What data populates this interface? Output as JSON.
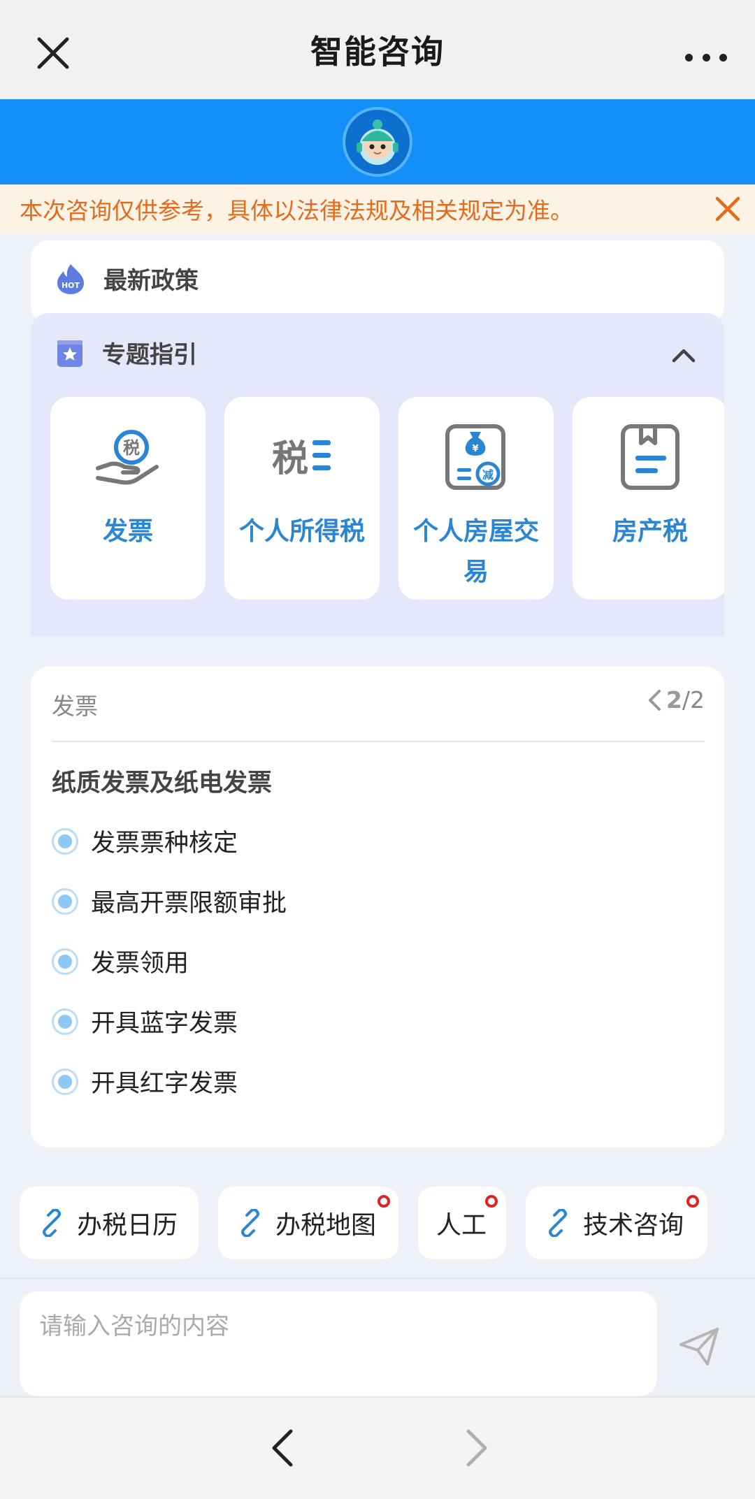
{
  "header": {
    "title": "智能咨询"
  },
  "notice": {
    "text": "本次咨询仅供参考，具体以法律法规及相关规定为准。"
  },
  "policy": {
    "label": "最新政策",
    "hot_badge": "HOT"
  },
  "topics": {
    "label": "专题指引",
    "tiles": [
      {
        "label": "发票",
        "icon": "tax-hand-icon"
      },
      {
        "label": "个人所得税",
        "icon": "tax-list-icon"
      },
      {
        "label": "个人房屋交易",
        "icon": "money-bag-icon"
      },
      {
        "label": "房产税",
        "icon": "document-icon"
      }
    ]
  },
  "list": {
    "category": "发票",
    "pager": {
      "current": "2",
      "total": "/2"
    },
    "title": "纸质发票及纸电发票",
    "items": [
      "发票票种核定",
      "最高开票限额审批",
      "发票领用",
      "开具蓝字发票",
      "开具红字发票"
    ]
  },
  "shortcuts": [
    {
      "label": "办税日历",
      "has_dot": false
    },
    {
      "label": "办税地图",
      "has_dot": true
    },
    {
      "label": "人工",
      "has_dot": true
    },
    {
      "label": "技术咨询",
      "has_dot": true
    }
  ],
  "input": {
    "placeholder": "请输入咨询的内容"
  },
  "colors": {
    "brand_blue": "#1390f7",
    "notice_orange": "#e36b1e",
    "tile_text": "#2a86d4",
    "dot_red": "#e02424"
  }
}
